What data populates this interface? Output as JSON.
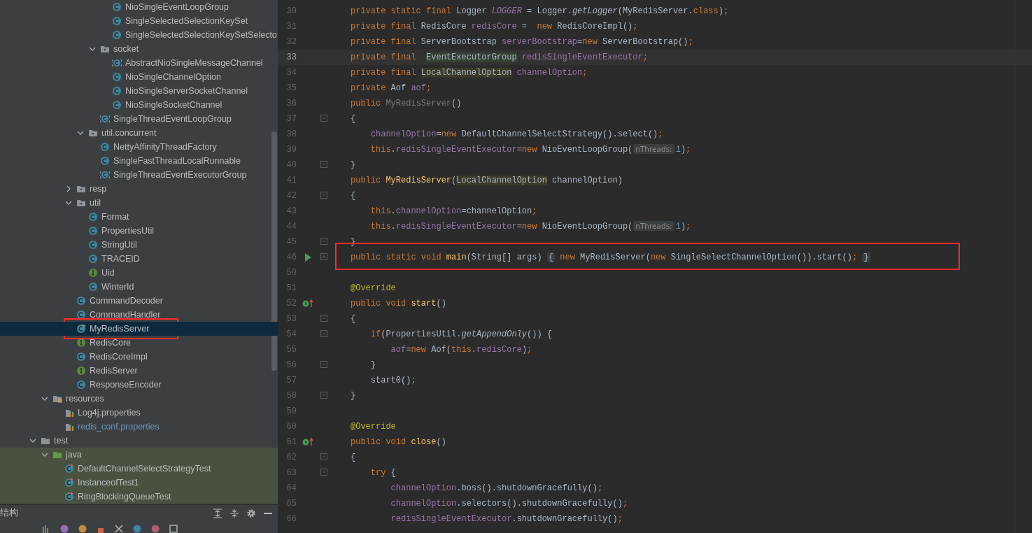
{
  "project_tree": {
    "items": [
      {
        "children": [
          {
            "children": [
              {
                "children": [
                  {
                    "children": [
                      {
                        "children": [
                          {
                            "children": [
                              {
                                "label": "NioSingleEventLoopGroup",
                                "kind": "class",
                                "selected": false,
                                "outlined": false,
                                "modified": false
                              },
                              {
                                "label": "SingleSelectedSelectionKeySet",
                                "kind": "class",
                                "selected": false,
                                "outlined": false,
                                "modified": false
                              },
                              {
                                "label": "SingleSelectedSelectionKeySetSelecto",
                                "kind": "class",
                                "selected": false,
                                "outlined": false,
                                "modified": false
                              }
                            ]
                          },
                          {
                            "label": "socket",
                            "kind": "folder",
                            "expanded": true,
                            "selected": false,
                            "outlined": false,
                            "modified": false,
                            "children": [
                              {
                                "label": "AbstractNioSingleMessageChannel",
                                "kind": "abstract",
                                "selected": false,
                                "outlined": false,
                                "modified": false
                              },
                              {
                                "label": "NioSingleChannelOption",
                                "kind": "class",
                                "selected": false,
                                "outlined": false,
                                "modified": false
                              },
                              {
                                "label": "NioSingleServerSocketChannel",
                                "kind": "class",
                                "selected": false,
                                "outlined": false,
                                "modified": false
                              },
                              {
                                "label": "NioSingleSocketChannel",
                                "kind": "class",
                                "selected": false,
                                "outlined": false,
                                "modified": false
                              }
                            ]
                          },
                          {
                            "label": "SingleThreadEventLoopGroup",
                            "kind": "abstract",
                            "selected": false,
                            "outlined": false,
                            "modified": false
                          }
                        ]
                      },
                      {
                        "label": "util.concurrent",
                        "kind": "folder",
                        "expanded": true,
                        "selected": false,
                        "outlined": false,
                        "modified": false,
                        "children": [
                          {
                            "label": "NettyAffinityThreadFactory",
                            "kind": "class",
                            "selected": false,
                            "outlined": false,
                            "modified": false
                          },
                          {
                            "label": "SingleFastThreadLocalRunnable",
                            "kind": "class",
                            "selected": false,
                            "outlined": false,
                            "modified": false
                          },
                          {
                            "label": "SingleThreadEventExecutorGroup",
                            "kind": "abstract",
                            "selected": false,
                            "outlined": false,
                            "modified": false
                          }
                        ]
                      }
                    ]
                  },
                  {
                    "label": "resp",
                    "kind": "folder",
                    "expanded": false,
                    "selected": false,
                    "outlined": false,
                    "modified": false
                  },
                  {
                    "label": "util",
                    "kind": "folder",
                    "expanded": true,
                    "selected": false,
                    "outlined": false,
                    "modified": false,
                    "children": [
                      {
                        "label": "Format",
                        "kind": "class",
                        "selected": false,
                        "outlined": false,
                        "modified": false
                      },
                      {
                        "label": "PropertiesUtil",
                        "kind": "class",
                        "selected": false,
                        "outlined": false,
                        "modified": false
                      },
                      {
                        "label": "StringUtil",
                        "kind": "class",
                        "selected": false,
                        "outlined": false,
                        "modified": false
                      },
                      {
                        "label": "TRACEID",
                        "kind": "class",
                        "selected": false,
                        "outlined": false,
                        "modified": false
                      },
                      {
                        "label": "Uid",
                        "kind": "interface",
                        "selected": false,
                        "outlined": false,
                        "modified": false
                      },
                      {
                        "label": "WinterId",
                        "kind": "class",
                        "selected": false,
                        "outlined": false,
                        "modified": false
                      }
                    ]
                  },
                  {
                    "label": "CommandDecoder",
                    "kind": "class",
                    "selected": false,
                    "outlined": false,
                    "modified": false
                  },
                  {
                    "label": "CommandHandler",
                    "kind": "class",
                    "selected": false,
                    "outlined": false,
                    "modified": false
                  },
                  {
                    "label": "MyRedisServer",
                    "kind": "main-class",
                    "selected": true,
                    "outlined": true,
                    "modified": false
                  },
                  {
                    "label": "RedisCore",
                    "kind": "interface",
                    "selected": false,
                    "outlined": false,
                    "modified": false
                  },
                  {
                    "label": "RedisCoreImpl",
                    "kind": "class",
                    "selected": false,
                    "outlined": false,
                    "modified": false
                  },
                  {
                    "label": "RedisServer",
                    "kind": "interface",
                    "selected": false,
                    "outlined": false,
                    "modified": false
                  },
                  {
                    "label": "ResponseEncoder",
                    "kind": "class",
                    "selected": false,
                    "outlined": false,
                    "modified": false
                  }
                ]
              }
            ]
          },
          {
            "label": "resources",
            "kind": "resources",
            "expanded": true,
            "selected": false,
            "outlined": false,
            "modified": false,
            "children": [
              {
                "label": "Log4j.properties",
                "kind": "properties",
                "selected": false,
                "outlined": false,
                "modified": false
              },
              {
                "label": "redis_conf.properties",
                "kind": "properties",
                "selected": false,
                "outlined": false,
                "modified": true
              }
            ]
          }
        ]
      },
      {
        "label": "test",
        "kind": "test-root",
        "expanded": true,
        "selected": false,
        "outlined": false,
        "modified": false,
        "children": [
          {
            "label": "java",
            "kind": "test-source",
            "expanded": true,
            "selected": false,
            "outlined": false,
            "modified": false,
            "children": [
              {
                "label": "DefaultChannelSelectStrategyTest",
                "kind": "test-class",
                "selected": false,
                "outlined": false,
                "modified": false
              },
              {
                "label": "InstanceofTest1",
                "kind": "test-class",
                "selected": false,
                "outlined": false,
                "modified": false
              },
              {
                "label": "RingBlockingQueueTest",
                "kind": "test-class",
                "selected": false,
                "outlined": false,
                "modified": false
              }
            ]
          }
        ]
      }
    ]
  },
  "structure_panel": {
    "title": "结构"
  },
  "editor": {
    "lines": [
      {
        "number": "30",
        "kind": "plain",
        "current": false,
        "outlined": false,
        "tokens": [
          {
            "kind": "keyword",
            "text": "private static final "
          },
          {
            "kind": "plain",
            "text": "Logger "
          },
          {
            "kind": "static-field",
            "text": "LOGGER"
          },
          {
            "kind": "plain",
            "text": " = Logger."
          },
          {
            "kind": "static-call",
            "text": "getLogger"
          },
          {
            "kind": "plain",
            "text": "(MyRedisServer."
          },
          {
            "kind": "keyword",
            "text": "class"
          },
          {
            "kind": "plain",
            "text": ")"
          },
          {
            "kind": "keyword",
            "text": ";"
          }
        ]
      },
      {
        "number": "31",
        "kind": "plain",
        "current": false,
        "outlined": false,
        "tokens": [
          {
            "kind": "keyword",
            "text": "private final "
          },
          {
            "kind": "plain",
            "text": "RedisCore "
          },
          {
            "kind": "field",
            "text": "redisCore"
          },
          {
            "kind": "plain",
            "text": " =  "
          },
          {
            "kind": "keyword",
            "text": "new "
          },
          {
            "kind": "plain",
            "text": "RedisCoreImpl()"
          },
          {
            "kind": "keyword",
            "text": ";"
          }
        ]
      },
      {
        "number": "32",
        "kind": "plain",
        "current": false,
        "outlined": false,
        "tokens": [
          {
            "kind": "keyword",
            "text": "private final "
          },
          {
            "kind": "plain",
            "text": "ServerBootstrap "
          },
          {
            "kind": "field",
            "text": "serverBootstrap"
          },
          {
            "kind": "plain",
            "text": "="
          },
          {
            "kind": "keyword",
            "text": "new "
          },
          {
            "kind": "plain",
            "text": "ServerBootstrap()"
          },
          {
            "kind": "keyword",
            "text": ";"
          }
        ]
      },
      {
        "number": "33",
        "kind": "plain",
        "current": true,
        "outlined": false,
        "tokens": [
          {
            "kind": "keyword",
            "text": "private final  "
          },
          {
            "kind": "usage",
            "text": "EventExecutorGroup"
          },
          {
            "kind": "field",
            "text": " redisSingleEventExecutor"
          },
          {
            "kind": "keyword",
            "text": ";"
          }
        ]
      },
      {
        "number": "34",
        "kind": "plain",
        "current": false,
        "outlined": false,
        "tokens": [
          {
            "kind": "keyword",
            "text": "private final "
          },
          {
            "kind": "marked",
            "text": "LocalChannelOption"
          },
          {
            "kind": "field",
            "text": " channelOption"
          },
          {
            "kind": "keyword",
            "text": ";"
          }
        ]
      },
      {
        "number": "35",
        "kind": "plain",
        "current": false,
        "outlined": false,
        "tokens": [
          {
            "kind": "keyword",
            "text": "private "
          },
          {
            "kind": "plain",
            "text": "Aof "
          },
          {
            "kind": "field",
            "text": "aof"
          },
          {
            "kind": "keyword",
            "text": ";"
          }
        ]
      },
      {
        "number": "36",
        "kind": "plain",
        "current": false,
        "outlined": false,
        "tokens": [
          {
            "kind": "keyword",
            "text": "public "
          },
          {
            "kind": "unused",
            "text": "MyRedisServer"
          },
          {
            "kind": "plain",
            "text": "()"
          }
        ]
      },
      {
        "number": "37",
        "kind": "fold",
        "current": false,
        "outlined": false,
        "tokens": [
          {
            "kind": "plain",
            "text": "{"
          }
        ]
      },
      {
        "number": "38",
        "kind": "plain",
        "current": false,
        "outlined": false,
        "tokens": [
          {
            "kind": "field",
            "text": "    channelOption"
          },
          {
            "kind": "plain",
            "text": "="
          },
          {
            "kind": "keyword",
            "text": "new "
          },
          {
            "kind": "plain",
            "text": "DefaultChannelSelectStrategy().select()"
          },
          {
            "kind": "keyword",
            "text": ";"
          }
        ]
      },
      {
        "number": "39",
        "kind": "plain",
        "current": false,
        "outlined": false,
        "tokens": [
          {
            "kind": "keyword",
            "text": "    this"
          },
          {
            "kind": "plain",
            "text": "."
          },
          {
            "kind": "field",
            "text": "redisSingleEventExecutor"
          },
          {
            "kind": "plain",
            "text": "="
          },
          {
            "kind": "keyword",
            "text": "new "
          },
          {
            "kind": "plain",
            "text": "NioEventLoopGroup("
          },
          {
            "kind": "hint",
            "text": "nThreads:"
          },
          {
            "kind": "number",
            "text": "1"
          },
          {
            "kind": "plain",
            "text": ")"
          },
          {
            "kind": "keyword",
            "text": ";"
          }
        ]
      },
      {
        "number": "40",
        "kind": "fold",
        "current": false,
        "outlined": false,
        "tokens": [
          {
            "kind": "plain",
            "text": "}"
          }
        ]
      },
      {
        "number": "41",
        "kind": "plain",
        "current": false,
        "outlined": false,
        "tokens": [
          {
            "kind": "keyword",
            "text": "public "
          },
          {
            "kind": "method",
            "text": "MyRedisServer"
          },
          {
            "kind": "plain",
            "text": "("
          },
          {
            "kind": "marked",
            "text": "LocalChannelOption"
          },
          {
            "kind": "plain",
            "text": " channelOption)"
          }
        ]
      },
      {
        "number": "42",
        "kind": "fold",
        "current": false,
        "outlined": false,
        "tokens": [
          {
            "kind": "plain",
            "text": "{"
          }
        ]
      },
      {
        "number": "43",
        "kind": "plain",
        "current": false,
        "outlined": false,
        "tokens": [
          {
            "kind": "keyword",
            "text": "    this"
          },
          {
            "kind": "plain",
            "text": "."
          },
          {
            "kind": "field",
            "text": "channelOption"
          },
          {
            "kind": "plain",
            "text": "=channelOption"
          },
          {
            "kind": "keyword",
            "text": ";"
          }
        ]
      },
      {
        "number": "44",
        "kind": "plain",
        "current": false,
        "outlined": false,
        "tokens": [
          {
            "kind": "keyword",
            "text": "    this"
          },
          {
            "kind": "plain",
            "text": "."
          },
          {
            "kind": "field",
            "text": "redisSingleEventExecutor"
          },
          {
            "kind": "plain",
            "text": "="
          },
          {
            "kind": "keyword",
            "text": "new "
          },
          {
            "kind": "plain",
            "text": "NioEventLoopGroup("
          },
          {
            "kind": "hint",
            "text": "nThreads:"
          },
          {
            "kind": "number",
            "text": "1"
          },
          {
            "kind": "plain",
            "text": ")"
          },
          {
            "kind": "keyword",
            "text": ";"
          }
        ]
      },
      {
        "number": "45",
        "kind": "fold",
        "current": false,
        "outlined": false,
        "tokens": [
          {
            "kind": "plain",
            "text": "}"
          }
        ]
      },
      {
        "number": "46",
        "kind": "run",
        "current": false,
        "outlined": true,
        "tokens": [
          {
            "kind": "keyword",
            "text": "public static void "
          },
          {
            "kind": "method",
            "text": "main"
          },
          {
            "kind": "plain",
            "text": "(String[] args) "
          },
          {
            "kind": "fold",
            "text": "{"
          },
          {
            "kind": "keyword",
            "text": " new "
          },
          {
            "kind": "plain",
            "text": "MyRedisServer("
          },
          {
            "kind": "keyword",
            "text": "new "
          },
          {
            "kind": "plain",
            "text": "SingleSelectChannelOption()).start()"
          },
          {
            "kind": "keyword",
            "text": "; "
          },
          {
            "kind": "fold",
            "text": "}"
          }
        ]
      },
      {
        "number": "50",
        "kind": "plain",
        "current": false,
        "outlined": false
      },
      {
        "number": "51",
        "kind": "plain",
        "current": false,
        "outlined": false,
        "tokens": [
          {
            "kind": "annotation",
            "text": "@Override"
          }
        ]
      },
      {
        "number": "52",
        "kind": "override",
        "current": false,
        "outlined": false,
        "tokens": [
          {
            "kind": "keyword",
            "text": "public void "
          },
          {
            "kind": "method",
            "text": "start"
          },
          {
            "kind": "plain",
            "text": "()"
          }
        ]
      },
      {
        "number": "53",
        "kind": "fold",
        "current": false,
        "outlined": false,
        "tokens": [
          {
            "kind": "plain",
            "text": "{"
          }
        ]
      },
      {
        "number": "54",
        "kind": "fold",
        "current": false,
        "outlined": false,
        "tokens": [
          {
            "kind": "keyword",
            "text": "    if"
          },
          {
            "kind": "plain",
            "text": "(PropertiesUtil."
          },
          {
            "kind": "static-call",
            "text": "getAppendOnly"
          },
          {
            "kind": "plain",
            "text": "()) {"
          }
        ]
      },
      {
        "number": "55",
        "kind": "plain",
        "current": false,
        "outlined": false,
        "tokens": [
          {
            "kind": "field",
            "text": "        aof"
          },
          {
            "kind": "plain",
            "text": "="
          },
          {
            "kind": "keyword",
            "text": "new "
          },
          {
            "kind": "plain",
            "text": "Aof("
          },
          {
            "kind": "keyword",
            "text": "this"
          },
          {
            "kind": "plain",
            "text": "."
          },
          {
            "kind": "field",
            "text": "redisCore"
          },
          {
            "kind": "plain",
            "text": ")"
          },
          {
            "kind": "keyword",
            "text": ";"
          }
        ]
      },
      {
        "number": "56",
        "kind": "fold",
        "current": false,
        "outlined": false,
        "tokens": [
          {
            "kind": "plain",
            "text": "    }"
          }
        ]
      },
      {
        "number": "57",
        "kind": "plain",
        "current": false,
        "outlined": false,
        "tokens": [
          {
            "kind": "plain",
            "text": "    start0()"
          },
          {
            "kind": "keyword",
            "text": ";"
          }
        ]
      },
      {
        "number": "58",
        "kind": "fold",
        "current": false,
        "outlined": false,
        "tokens": [
          {
            "kind": "plain",
            "text": "}"
          }
        ]
      },
      {
        "number": "59",
        "kind": "plain",
        "current": false,
        "outlined": false
      },
      {
        "number": "60",
        "kind": "plain",
        "current": false,
        "outlined": false,
        "tokens": [
          {
            "kind": "annotation",
            "text": "@Override"
          }
        ]
      },
      {
        "number": "61",
        "kind": "override",
        "current": false,
        "outlined": false,
        "tokens": [
          {
            "kind": "keyword",
            "text": "public void "
          },
          {
            "kind": "method",
            "text": "close"
          },
          {
            "kind": "plain",
            "text": "()"
          }
        ]
      },
      {
        "number": "62",
        "kind": "fold",
        "current": false,
        "outlined": false,
        "tokens": [
          {
            "kind": "plain",
            "text": "{"
          }
        ]
      },
      {
        "number": "63",
        "kind": "fold",
        "current": false,
        "outlined": false,
        "tokens": [
          {
            "kind": "keyword",
            "text": "    try "
          },
          {
            "kind": "plain",
            "text": "{"
          }
        ]
      },
      {
        "number": "64",
        "kind": "plain",
        "current": false,
        "outlined": false,
        "tokens": [
          {
            "kind": "field",
            "text": "        channelOption"
          },
          {
            "kind": "plain",
            "text": ".boss().shutdownGracefully()"
          },
          {
            "kind": "keyword",
            "text": ";"
          }
        ]
      },
      {
        "number": "65",
        "kind": "plain",
        "current": false,
        "outlined": false,
        "tokens": [
          {
            "kind": "field",
            "text": "        channelOption"
          },
          {
            "kind": "plain",
            "text": ".selectors().shutdownGracefully()"
          },
          {
            "kind": "keyword",
            "text": ";"
          }
        ]
      },
      {
        "number": "66",
        "kind": "plain",
        "current": false,
        "outlined": false,
        "tokens": [
          {
            "kind": "field",
            "text": "        redisSingleEventExecutor"
          },
          {
            "kind": "plain",
            "text": ".shutdownGracefully()"
          },
          {
            "kind": "keyword",
            "text": ";"
          }
        ]
      }
    ]
  }
}
